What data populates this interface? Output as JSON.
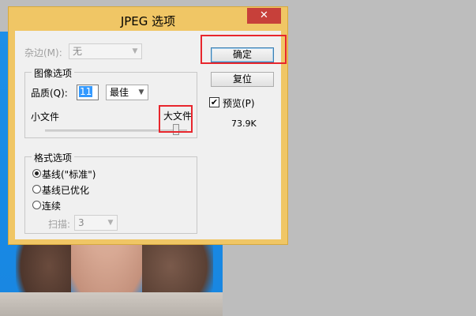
{
  "window": {
    "title": "JPEG 选项",
    "close_glyph": "✕"
  },
  "matte": {
    "label": "杂边(M):",
    "value": "无"
  },
  "image_options": {
    "group_title": "图像选项",
    "quality_label": "品质(Q):",
    "quality_value": "11",
    "quality_preset": "最佳",
    "small_file_label": "小文件",
    "large_file_label": "大文件",
    "slider_level": 0.92
  },
  "format_options": {
    "group_title": "格式选项",
    "options": [
      {
        "label": "基线(\"标准\")",
        "checked": true
      },
      {
        "label": "基线已优化",
        "checked": false
      },
      {
        "label": "连续",
        "checked": false
      }
    ],
    "scans_label": "扫描:",
    "scans_value": "3"
  },
  "buttons": {
    "ok": "确定",
    "reset": "复位"
  },
  "preview": {
    "label": "预览(P)",
    "checked": true,
    "checkmark": "✔",
    "file_size": "73.9K"
  },
  "colors": {
    "highlight": "#e8262d",
    "titlebar": "#f0c665",
    "close": "#c7403a"
  }
}
